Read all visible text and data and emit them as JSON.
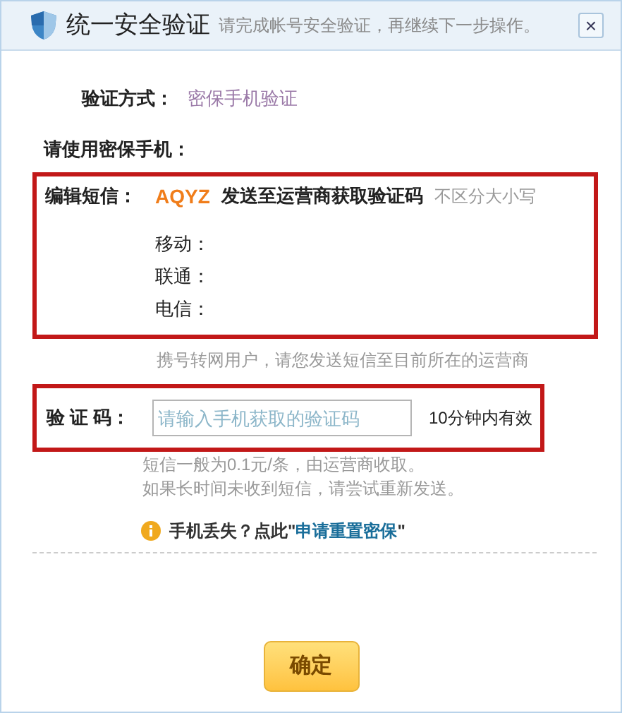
{
  "window": {
    "title": "统一安全验证",
    "subtitle": "请完成帐号安全验证，再继续下一步操作。",
    "close": "×"
  },
  "method": {
    "label": "验证方式：",
    "value": "密保手机验证"
  },
  "phone": {
    "label": "请使用密保手机："
  },
  "sms": {
    "label": "编辑短信：",
    "code": "AQYZ",
    "instruction": "发送至运营商获取验证码",
    "note": "不区分大小写",
    "carriers": [
      {
        "label": "移动："
      },
      {
        "label": "联通："
      },
      {
        "label": "电信："
      }
    ]
  },
  "sms_hint": "携号转网用户，请您发送短信至目前所在的运营商",
  "code_field": {
    "label": "验 证 码：",
    "placeholder": "请输入手机获取的验证码",
    "validity": "10分钟内有效"
  },
  "notes": [
    "短信一般为0.1元/条，由运营商收取。",
    "如果长时间未收到短信，请尝试重新发送。"
  ],
  "help": {
    "prefix": "手机丢失？点此\"",
    "link": "申请重置密保",
    "suffix": "\""
  },
  "buttons": [
    "确定"
  ]
}
